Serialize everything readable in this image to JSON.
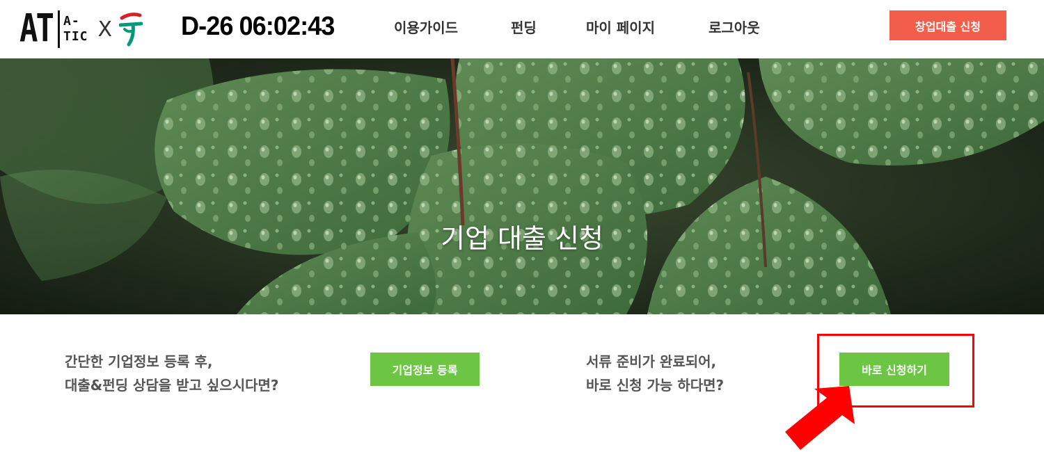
{
  "header": {
    "logo_at": "AT",
    "logo_atic_top": "A-",
    "logo_atic_bottom": "TIC",
    "logo_x": "X",
    "timer": "D-26 06:02:43",
    "nav": [
      "이용가이드",
      "펀딩",
      "마이 페이지",
      "로그아웃"
    ],
    "cta_label": "창업대출 신청"
  },
  "hero": {
    "title": "기업 대출 신청"
  },
  "section": {
    "left_text_line1": "간단한 기업정보 등록 후,",
    "left_text_line2": "대출&펀딩 상담을 받고 싶으시다면?",
    "left_button": "기업정보 등록",
    "right_text_line1": "서류 준비가 완료되어,",
    "right_text_line2": "바로 신청 가능 하다면?",
    "right_button": "바로 신청하기"
  },
  "colors": {
    "cta_orange": "#f25e4a",
    "green_button": "#6cc644",
    "highlight_red": "#ff0000"
  },
  "icons": [
    "hana-bank-logo-icon",
    "arrow-pointer-icon"
  ]
}
